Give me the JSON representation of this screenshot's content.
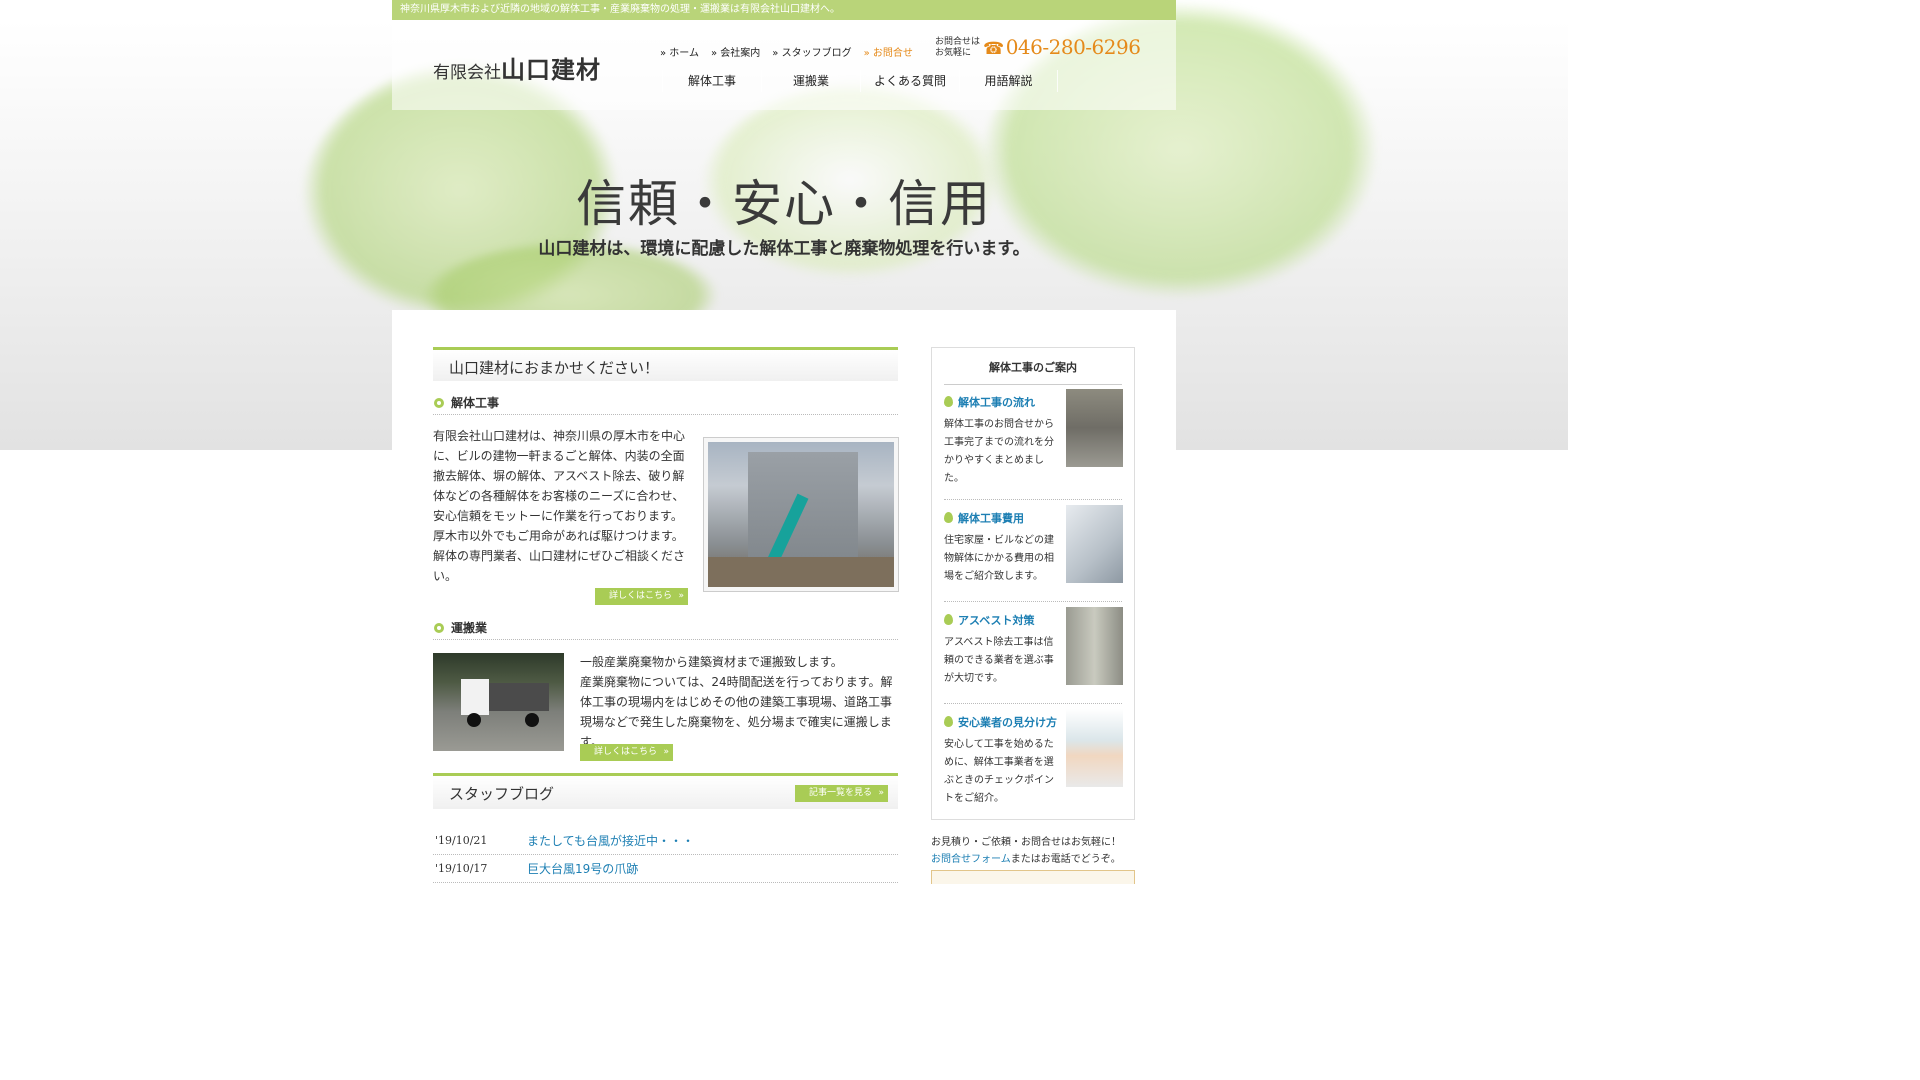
{
  "topbar": {
    "text": "神奈川県厚木市および近隣の地域の解体工事・産業廃棄物の処理・運搬業は有限会社山口建材へ。"
  },
  "header": {
    "logo_small": "有限会社",
    "logo_big": "山口建材",
    "topnav": [
      {
        "label": "ホーム"
      },
      {
        "label": "会社案内"
      },
      {
        "label": "スタッフブログ"
      },
      {
        "label": "お問合せ"
      }
    ],
    "tel_note_1": "お問合せは",
    "tel_note_2": "お気軽に",
    "phone_icon": "☎",
    "tel": "046-280-6296",
    "gnav": [
      {
        "label": "解体工事"
      },
      {
        "label": "運搬業"
      },
      {
        "label": "よくある質問"
      },
      {
        "label": "用語解説"
      }
    ]
  },
  "hero": {
    "title": "信頼・安心・信用",
    "subtitle": "山口建材は、環境に配慮した解体工事と廃棄物処理を行います。"
  },
  "main": {
    "heading": "山口建材におまかせください！",
    "demolition": {
      "heading": "解体工事",
      "text_1": "有限会社山口建材は、神奈川県の厚木市を中心に、ビルの建物一軒まるごと解体、内装の全面撤去解体、塀の解体、アスベスト除去、破り解体などの各種解体をお客様のニーズに合わせ、安心信頼をモットーに作業を行っております。",
      "text_2": "厚木市以外でもご用命があれば駆けつけます。解体の専門業者、山口建材にぜひご相談ください。",
      "more": "詳しくはこちら"
    },
    "transport": {
      "heading": "運搬業",
      "text_1": "一般産業廃棄物から建築資材まで運搬致します。",
      "text_2": "産業廃棄物については、24時間配送を行っております。解体工事の現場内をはじめその他の建築工事現場、道路工事現場などで発生した廃棄物を、処分場まで確実に運搬します。",
      "more": "詳しくはこちら"
    },
    "blog": {
      "heading": "スタッフブログ",
      "list_button": "記事一覧を見る",
      "entries": [
        {
          "date": "'19/10/21",
          "title": "またしても台風が接近中・・・"
        },
        {
          "date": "'19/10/17",
          "title": "巨大台風19号の爪跡"
        }
      ]
    }
  },
  "sidebar": {
    "title": "解体工事のご案内",
    "items": [
      {
        "title": "解体工事の流れ",
        "text": "解体工事のお問合せから工事完了までの流れを分かりやすくまとめました。"
      },
      {
        "title": "解体工事費用",
        "text": "住宅家屋・ビルなどの建物解体にかかる費用の相場をご紹介致します。"
      },
      {
        "title": "アスベスト対策",
        "text": "アスベスト除去工事は信頼のできる業者を選ぶ事が大切です。"
      },
      {
        "title": "安心業者の見分け方",
        "text": "安心して工事を始めるために、解体工事業者を選ぶときのチェックポイントをご紹介。"
      }
    ],
    "note_1": "お見積り・ご依頼・お問合せはお気軽に！",
    "note_link": "お問合せフォーム",
    "note_2": "またはお電話でどうぞ。"
  },
  "colors": {
    "accent_green": "#a9cc55",
    "link_blue": "#1d7fb3",
    "orange": "#e58a1a"
  }
}
